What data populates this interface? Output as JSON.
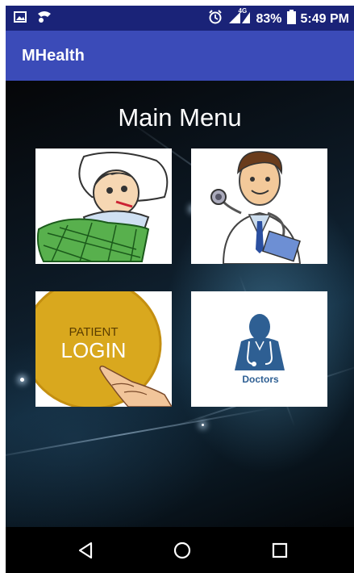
{
  "status_bar": {
    "battery": "83%",
    "time": "5:49 PM",
    "network": "4G",
    "icons": [
      "image-icon",
      "signal-icon",
      "alarm-icon",
      "cell-signal-icon",
      "battery-icon"
    ]
  },
  "app_bar": {
    "title": "MHealth"
  },
  "main": {
    "title": "Main Menu",
    "tiles": [
      {
        "icon": "sick-patient-icon"
      },
      {
        "icon": "doctor-stethoscope-icon"
      },
      {
        "icon": "patient-login-icon",
        "line1": "PATIENT",
        "line2": "LOGIN"
      },
      {
        "icon": "doctors-icon",
        "label": "Doctors"
      }
    ]
  },
  "nav_bar": {
    "buttons": [
      "back-icon",
      "home-icon",
      "recents-icon"
    ]
  },
  "colors": {
    "status_bar": "#1a2378",
    "app_bar": "#3b4bb8",
    "login_gold": "#d9a81e",
    "doctors_blue": "#2e5f93"
  }
}
